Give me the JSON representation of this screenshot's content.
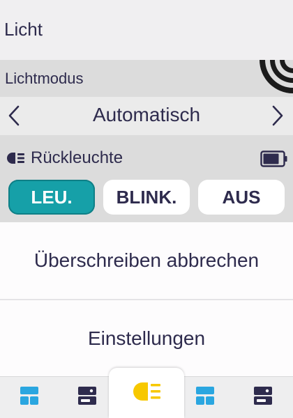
{
  "header": {
    "title": "Licht"
  },
  "light_mode": {
    "label": "Lichtmodus",
    "value": "Automatisch",
    "prev_icon": "chevron-left-icon",
    "next_icon": "chevron-right-icon",
    "status_icon": "signal-icon"
  },
  "rear_light": {
    "label": "Rückleuchte",
    "icon": "rear-light-icon",
    "battery_icon": "battery-icon",
    "options": [
      {
        "label": "LEU.",
        "active": true
      },
      {
        "label": "BLINK.",
        "active": false
      },
      {
        "label": "AUS",
        "active": false
      }
    ]
  },
  "menu": {
    "items": [
      {
        "label": "Überschreiben abbrechen"
      },
      {
        "label": "Einstellungen"
      }
    ]
  },
  "nav": {
    "tabs": [
      {
        "icon": "dashboard-icon"
      },
      {
        "icon": "device-icon"
      },
      {
        "icon": "light-icon",
        "active": true
      },
      {
        "icon": "dashboard-icon"
      },
      {
        "icon": "device-icon"
      }
    ]
  },
  "colors": {
    "accent": "#16a0a8",
    "text": "#2e2b4d",
    "nav_blue": "#2aa6e0",
    "light_yellow": "#f7c800"
  }
}
